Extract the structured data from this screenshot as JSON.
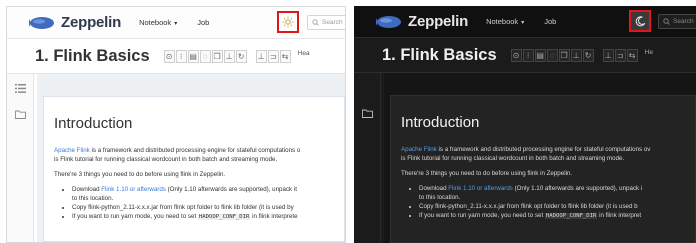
{
  "brand": "Zeppelin",
  "menu": {
    "notebook": "Notebook",
    "job": "Job",
    "caret": "▾"
  },
  "search": {
    "placeholder_light": "Search",
    "placeholder_dark": "Search"
  },
  "notebook": {
    "title": "1. Flink Basics",
    "head_label": "Hea",
    "head_label_dark": "He"
  },
  "toolbar_icons": [
    "play-all-icon",
    "hide-code-icon",
    "hide-output-icon",
    "clear-output-icon",
    "clone-icon",
    "export-icon",
    "reload-icon",
    "version-icon",
    "commit-icon",
    "compare-icon"
  ],
  "paragraph": {
    "heading": "Introduction",
    "intro_link": "Apache Flink",
    "intro_text": " is a framework and distributed processing engine for stateful computations o",
    "intro_text_dark": " is a framework and distributed processing engine for stateful computations ov",
    "intro_line2": "is Flink tutorial for running classical wordcount in both batch and streaming mode.",
    "things": "There're 3 things you need to do before using flink in Zeppelin.",
    "bullets": [
      {
        "pre": "Download ",
        "link": "Flink 1.10 or afterwards",
        "post": " (Only 1.10 afterwards are supported), unpack it",
        "post_dark": " (Only 1.10 afterwards are supported), unpack i"
      },
      {
        "pre": "to this location.",
        "link": "",
        "post": ""
      },
      {
        "pre": "Copy flink-python_2.11-x.x.x.jar from flink opt folder to flink lib folder (it is used by",
        "pre_dark": "Copy flink-python_2.11-x.x.x.jar from flink opt folder to flink lib folder (it is used b",
        "link": "",
        "post": ""
      },
      {
        "pre": "If you want to run yarn mode, you need to set ",
        "code": "HADOOP_CONF_DIR",
        "post": " in flink interprete",
        "post_dark": " in flink interpret"
      }
    ]
  },
  "colors": {
    "highlight": "#e2151b",
    "link": "#3a7bd5",
    "brand_blue": "#3f6cc0"
  }
}
